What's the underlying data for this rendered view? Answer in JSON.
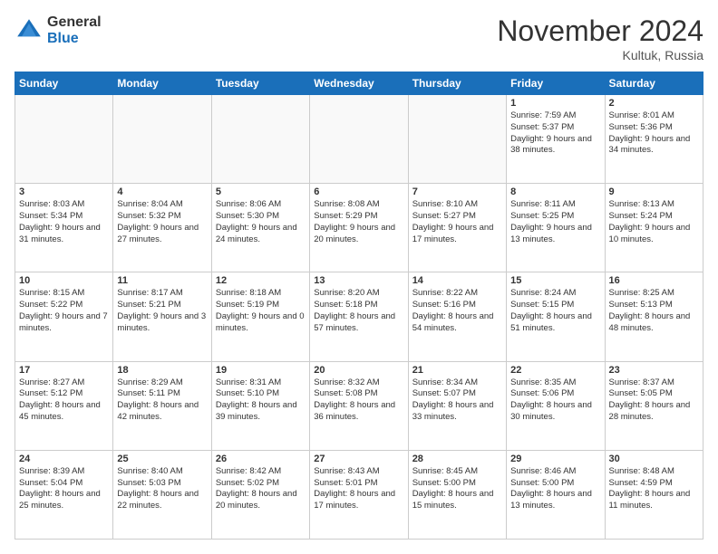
{
  "logo": {
    "general": "General",
    "blue": "Blue"
  },
  "title": "November 2024",
  "location": "Kultuk, Russia",
  "weekdays": [
    "Sunday",
    "Monday",
    "Tuesday",
    "Wednesday",
    "Thursday",
    "Friday",
    "Saturday"
  ],
  "weeks": [
    [
      {
        "day": "",
        "info": ""
      },
      {
        "day": "",
        "info": ""
      },
      {
        "day": "",
        "info": ""
      },
      {
        "day": "",
        "info": ""
      },
      {
        "day": "",
        "info": ""
      },
      {
        "day": "1",
        "info": "Sunrise: 7:59 AM\nSunset: 5:37 PM\nDaylight: 9 hours and 38 minutes."
      },
      {
        "day": "2",
        "info": "Sunrise: 8:01 AM\nSunset: 5:36 PM\nDaylight: 9 hours and 34 minutes."
      }
    ],
    [
      {
        "day": "3",
        "info": "Sunrise: 8:03 AM\nSunset: 5:34 PM\nDaylight: 9 hours and 31 minutes."
      },
      {
        "day": "4",
        "info": "Sunrise: 8:04 AM\nSunset: 5:32 PM\nDaylight: 9 hours and 27 minutes."
      },
      {
        "day": "5",
        "info": "Sunrise: 8:06 AM\nSunset: 5:30 PM\nDaylight: 9 hours and 24 minutes."
      },
      {
        "day": "6",
        "info": "Sunrise: 8:08 AM\nSunset: 5:29 PM\nDaylight: 9 hours and 20 minutes."
      },
      {
        "day": "7",
        "info": "Sunrise: 8:10 AM\nSunset: 5:27 PM\nDaylight: 9 hours and 17 minutes."
      },
      {
        "day": "8",
        "info": "Sunrise: 8:11 AM\nSunset: 5:25 PM\nDaylight: 9 hours and 13 minutes."
      },
      {
        "day": "9",
        "info": "Sunrise: 8:13 AM\nSunset: 5:24 PM\nDaylight: 9 hours and 10 minutes."
      }
    ],
    [
      {
        "day": "10",
        "info": "Sunrise: 8:15 AM\nSunset: 5:22 PM\nDaylight: 9 hours and 7 minutes."
      },
      {
        "day": "11",
        "info": "Sunrise: 8:17 AM\nSunset: 5:21 PM\nDaylight: 9 hours and 3 minutes."
      },
      {
        "day": "12",
        "info": "Sunrise: 8:18 AM\nSunset: 5:19 PM\nDaylight: 9 hours and 0 minutes."
      },
      {
        "day": "13",
        "info": "Sunrise: 8:20 AM\nSunset: 5:18 PM\nDaylight: 8 hours and 57 minutes."
      },
      {
        "day": "14",
        "info": "Sunrise: 8:22 AM\nSunset: 5:16 PM\nDaylight: 8 hours and 54 minutes."
      },
      {
        "day": "15",
        "info": "Sunrise: 8:24 AM\nSunset: 5:15 PM\nDaylight: 8 hours and 51 minutes."
      },
      {
        "day": "16",
        "info": "Sunrise: 8:25 AM\nSunset: 5:13 PM\nDaylight: 8 hours and 48 minutes."
      }
    ],
    [
      {
        "day": "17",
        "info": "Sunrise: 8:27 AM\nSunset: 5:12 PM\nDaylight: 8 hours and 45 minutes."
      },
      {
        "day": "18",
        "info": "Sunrise: 8:29 AM\nSunset: 5:11 PM\nDaylight: 8 hours and 42 minutes."
      },
      {
        "day": "19",
        "info": "Sunrise: 8:31 AM\nSunset: 5:10 PM\nDaylight: 8 hours and 39 minutes."
      },
      {
        "day": "20",
        "info": "Sunrise: 8:32 AM\nSunset: 5:08 PM\nDaylight: 8 hours and 36 minutes."
      },
      {
        "day": "21",
        "info": "Sunrise: 8:34 AM\nSunset: 5:07 PM\nDaylight: 8 hours and 33 minutes."
      },
      {
        "day": "22",
        "info": "Sunrise: 8:35 AM\nSunset: 5:06 PM\nDaylight: 8 hours and 30 minutes."
      },
      {
        "day": "23",
        "info": "Sunrise: 8:37 AM\nSunset: 5:05 PM\nDaylight: 8 hours and 28 minutes."
      }
    ],
    [
      {
        "day": "24",
        "info": "Sunrise: 8:39 AM\nSunset: 5:04 PM\nDaylight: 8 hours and 25 minutes."
      },
      {
        "day": "25",
        "info": "Sunrise: 8:40 AM\nSunset: 5:03 PM\nDaylight: 8 hours and 22 minutes."
      },
      {
        "day": "26",
        "info": "Sunrise: 8:42 AM\nSunset: 5:02 PM\nDaylight: 8 hours and 20 minutes."
      },
      {
        "day": "27",
        "info": "Sunrise: 8:43 AM\nSunset: 5:01 PM\nDaylight: 8 hours and 17 minutes."
      },
      {
        "day": "28",
        "info": "Sunrise: 8:45 AM\nSunset: 5:00 PM\nDaylight: 8 hours and 15 minutes."
      },
      {
        "day": "29",
        "info": "Sunrise: 8:46 AM\nSunset: 5:00 PM\nDaylight: 8 hours and 13 minutes."
      },
      {
        "day": "30",
        "info": "Sunrise: 8:48 AM\nSunset: 4:59 PM\nDaylight: 8 hours and 11 minutes."
      }
    ]
  ]
}
